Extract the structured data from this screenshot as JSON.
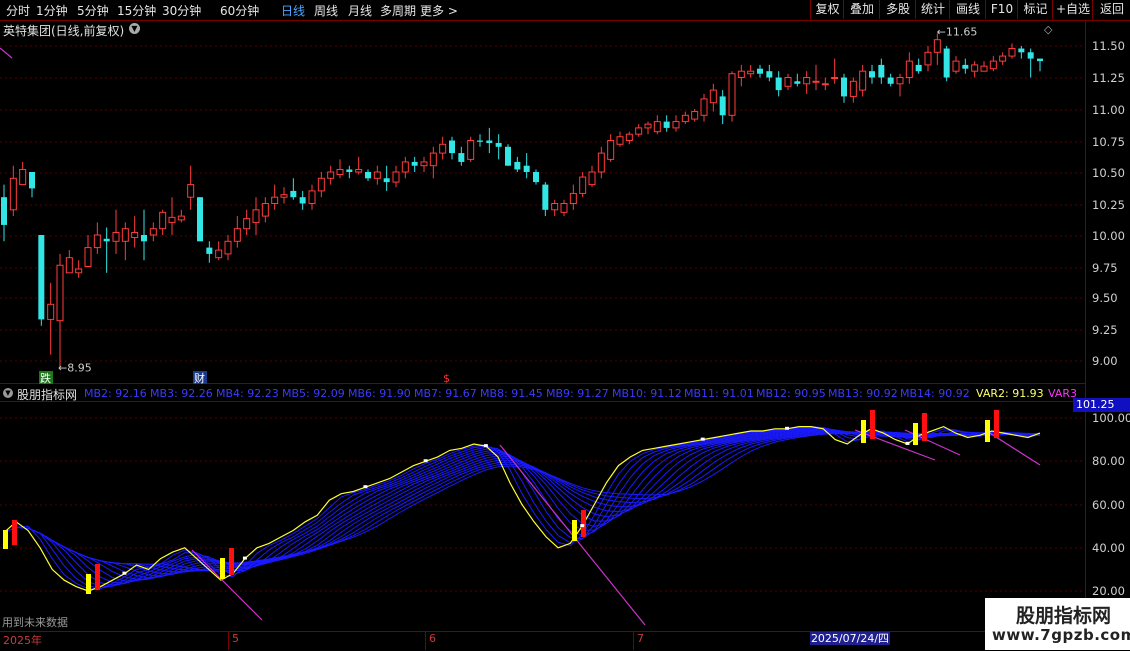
{
  "toolbar": {
    "left": [
      "分时",
      "1分钟",
      "5分钟",
      "15分钟",
      "30分钟",
      "60分钟",
      "日线",
      "周线",
      "月线",
      "多周期",
      "更多 >"
    ],
    "active_index": 6,
    "right": [
      "复权",
      "叠加",
      "多股",
      "统计",
      "画线",
      "F10",
      "标记",
      "+自选",
      "返回"
    ]
  },
  "chart_title": "英特集团(日线,前复权)",
  "price_axis": [
    "11.50",
    "11.25",
    "11.00",
    "10.75",
    "10.50",
    "10.25",
    "10.00",
    "9.75",
    "9.50",
    "9.25",
    "9.00"
  ],
  "price_annotations": {
    "high": "11.65",
    "low": "8.95"
  },
  "event_markers": [
    "跌",
    "财",
    "$"
  ],
  "indicator": {
    "name": "股朋指标网",
    "mb": [
      "MB2: 92.16",
      "MB3: 92.26",
      "MB4: 92.23",
      "MB5: 92.09",
      "MB6: 91.90",
      "MB7: 91.67",
      "MB8: 91.45",
      "MB9: 91.27",
      "MB10: 91.12",
      "MB11: 91.01",
      "MB12: 90.95",
      "MB13: 90.92",
      "MB14: 90.92"
    ],
    "var2": "VAR2: 91.93",
    "var3": "VAR3",
    "current_value": "101.25",
    "axis": [
      "100.00",
      "80.00",
      "60.00",
      "40.00",
      "20.00"
    ]
  },
  "note": "用到未来数据",
  "date_axis": {
    "labels": [
      "2025年",
      "5",
      "6",
      "7"
    ],
    "highlight": "2025/07/24/四"
  },
  "watermark": {
    "line1": "股朋指标网",
    "line2": "www.7gpzb.com"
  },
  "colors": {
    "up": "#ff3b3b",
    "down": "#33e6e6",
    "ribbon": "#1a1aff",
    "main_line": "#ffff33",
    "var3_line": "#cc33cc",
    "bar_yellow": "#ffff00",
    "bar_red": "#ff1010"
  },
  "chart_data": {
    "type": "candlestick",
    "candles": [
      {
        "o": 10.3,
        "h": 10.4,
        "l": 9.95,
        "c": 10.08
      },
      {
        "o": 10.2,
        "h": 10.55,
        "l": 10.15,
        "c": 10.45
      },
      {
        "o": 10.4,
        "h": 10.58,
        "l": 10.4,
        "c": 10.52
      },
      {
        "o": 10.5,
        "h": 10.5,
        "l": 10.3,
        "c": 10.37
      },
      {
        "o": 10.0,
        "h": 10.0,
        "l": 9.28,
        "c": 9.33
      },
      {
        "o": 9.33,
        "h": 9.62,
        "l": 9.05,
        "c": 9.45
      },
      {
        "o": 9.32,
        "h": 9.85,
        "l": 8.95,
        "c": 9.76
      },
      {
        "o": 9.7,
        "h": 9.88,
        "l": 9.7,
        "c": 9.82
      },
      {
        "o": 9.7,
        "h": 9.8,
        "l": 9.66,
        "c": 9.73
      },
      {
        "o": 9.75,
        "h": 10.0,
        "l": 9.75,
        "c": 9.9
      },
      {
        "o": 9.9,
        "h": 10.1,
        "l": 9.85,
        "c": 10.0
      },
      {
        "o": 9.97,
        "h": 10.06,
        "l": 9.7,
        "c": 9.95
      },
      {
        "o": 9.95,
        "h": 10.2,
        "l": 9.85,
        "c": 10.02
      },
      {
        "o": 9.95,
        "h": 10.1,
        "l": 9.8,
        "c": 10.05
      },
      {
        "o": 9.98,
        "h": 10.15,
        "l": 9.9,
        "c": 10.02
      },
      {
        "o": 10.0,
        "h": 10.2,
        "l": 9.8,
        "c": 9.95
      },
      {
        "o": 10.0,
        "h": 10.1,
        "l": 9.95,
        "c": 10.05
      },
      {
        "o": 10.05,
        "h": 10.2,
        "l": 10.0,
        "c": 10.18
      },
      {
        "o": 10.1,
        "h": 10.3,
        "l": 10.0,
        "c": 10.14
      },
      {
        "o": 10.12,
        "h": 10.2,
        "l": 10.1,
        "c": 10.15
      },
      {
        "o": 10.3,
        "h": 10.55,
        "l": 10.2,
        "c": 10.4
      },
      {
        "o": 10.3,
        "h": 10.3,
        "l": 9.95,
        "c": 9.95
      },
      {
        "o": 9.9,
        "h": 9.95,
        "l": 9.78,
        "c": 9.85
      },
      {
        "o": 9.82,
        "h": 9.95,
        "l": 9.8,
        "c": 9.88
      },
      {
        "o": 9.85,
        "h": 10.0,
        "l": 9.8,
        "c": 9.95
      },
      {
        "o": 9.95,
        "h": 10.15,
        "l": 9.9,
        "c": 10.05
      },
      {
        "o": 10.05,
        "h": 10.2,
        "l": 10.0,
        "c": 10.13
      },
      {
        "o": 10.1,
        "h": 10.3,
        "l": 10.0,
        "c": 10.2
      },
      {
        "o": 10.15,
        "h": 10.3,
        "l": 10.1,
        "c": 10.25
      },
      {
        "o": 10.25,
        "h": 10.4,
        "l": 10.2,
        "c": 10.3
      },
      {
        "o": 10.3,
        "h": 10.38,
        "l": 10.25,
        "c": 10.32
      },
      {
        "o": 10.35,
        "h": 10.45,
        "l": 10.28,
        "c": 10.3
      },
      {
        "o": 10.3,
        "h": 10.35,
        "l": 10.2,
        "c": 10.25
      },
      {
        "o": 10.25,
        "h": 10.4,
        "l": 10.2,
        "c": 10.35
      },
      {
        "o": 10.35,
        "h": 10.5,
        "l": 10.3,
        "c": 10.45
      },
      {
        "o": 10.45,
        "h": 10.55,
        "l": 10.4,
        "c": 10.5
      },
      {
        "o": 10.48,
        "h": 10.6,
        "l": 10.45,
        "c": 10.52
      },
      {
        "o": 10.52,
        "h": 10.55,
        "l": 10.45,
        "c": 10.5
      },
      {
        "o": 10.5,
        "h": 10.62,
        "l": 10.48,
        "c": 10.52
      },
      {
        "o": 10.5,
        "h": 10.52,
        "l": 10.43,
        "c": 10.45
      },
      {
        "o": 10.45,
        "h": 10.55,
        "l": 10.4,
        "c": 10.5
      },
      {
        "o": 10.45,
        "h": 10.55,
        "l": 10.35,
        "c": 10.42
      },
      {
        "o": 10.42,
        "h": 10.55,
        "l": 10.38,
        "c": 10.5
      },
      {
        "o": 10.5,
        "h": 10.62,
        "l": 10.45,
        "c": 10.58
      },
      {
        "o": 10.58,
        "h": 10.62,
        "l": 10.5,
        "c": 10.55
      },
      {
        "o": 10.55,
        "h": 10.62,
        "l": 10.5,
        "c": 10.58
      },
      {
        "o": 10.55,
        "h": 10.7,
        "l": 10.45,
        "c": 10.65
      },
      {
        "o": 10.65,
        "h": 10.78,
        "l": 10.6,
        "c": 10.72
      },
      {
        "o": 10.75,
        "h": 10.78,
        "l": 10.6,
        "c": 10.65
      },
      {
        "o": 10.65,
        "h": 10.7,
        "l": 10.55,
        "c": 10.58
      },
      {
        "o": 10.6,
        "h": 10.78,
        "l": 10.58,
        "c": 10.75
      },
      {
        "o": 10.75,
        "h": 10.8,
        "l": 10.7,
        "c": 10.74
      },
      {
        "o": 10.75,
        "h": 10.85,
        "l": 10.65,
        "c": 10.73
      },
      {
        "o": 10.73,
        "h": 10.8,
        "l": 10.6,
        "c": 10.7
      },
      {
        "o": 10.7,
        "h": 10.72,
        "l": 10.55,
        "c": 10.55
      },
      {
        "o": 10.58,
        "h": 10.62,
        "l": 10.5,
        "c": 10.52
      },
      {
        "o": 10.55,
        "h": 10.65,
        "l": 10.45,
        "c": 10.5
      },
      {
        "o": 10.5,
        "h": 10.52,
        "l": 10.4,
        "c": 10.42
      },
      {
        "o": 10.4,
        "h": 10.42,
        "l": 10.15,
        "c": 10.2
      },
      {
        "o": 10.2,
        "h": 10.28,
        "l": 10.15,
        "c": 10.25
      },
      {
        "o": 10.18,
        "h": 10.28,
        "l": 10.15,
        "c": 10.25
      },
      {
        "o": 10.25,
        "h": 10.4,
        "l": 10.2,
        "c": 10.33
      },
      {
        "o": 10.33,
        "h": 10.5,
        "l": 10.3,
        "c": 10.46
      },
      {
        "o": 10.4,
        "h": 10.55,
        "l": 10.38,
        "c": 10.5
      },
      {
        "o": 10.5,
        "h": 10.7,
        "l": 10.45,
        "c": 10.65
      },
      {
        "o": 10.6,
        "h": 10.8,
        "l": 10.58,
        "c": 10.75
      },
      {
        "o": 10.72,
        "h": 10.82,
        "l": 10.7,
        "c": 10.78
      },
      {
        "o": 10.75,
        "h": 10.82,
        "l": 10.72,
        "c": 10.8
      },
      {
        "o": 10.8,
        "h": 10.88,
        "l": 10.78,
        "c": 10.85
      },
      {
        "o": 10.85,
        "h": 10.9,
        "l": 10.8,
        "c": 10.88
      },
      {
        "o": 10.82,
        "h": 10.95,
        "l": 10.8,
        "c": 10.9
      },
      {
        "o": 10.9,
        "h": 10.95,
        "l": 10.82,
        "c": 10.85
      },
      {
        "o": 10.85,
        "h": 10.95,
        "l": 10.82,
        "c": 10.9
      },
      {
        "o": 10.9,
        "h": 10.98,
        "l": 10.88,
        "c": 10.95
      },
      {
        "o": 10.92,
        "h": 11.0,
        "l": 10.9,
        "c": 10.98
      },
      {
        "o": 10.95,
        "h": 11.12,
        "l": 10.9,
        "c": 11.08
      },
      {
        "o": 11.05,
        "h": 11.2,
        "l": 10.98,
        "c": 11.15
      },
      {
        "o": 11.1,
        "h": 11.15,
        "l": 10.88,
        "c": 10.95
      },
      {
        "o": 10.95,
        "h": 11.3,
        "l": 10.9,
        "c": 11.28
      },
      {
        "o": 11.25,
        "h": 11.35,
        "l": 11.18,
        "c": 11.3
      },
      {
        "o": 11.28,
        "h": 11.35,
        "l": 11.25,
        "c": 11.3
      },
      {
        "o": 11.32,
        "h": 11.35,
        "l": 11.25,
        "c": 11.28
      },
      {
        "o": 11.3,
        "h": 11.35,
        "l": 11.22,
        "c": 11.25
      },
      {
        "o": 11.25,
        "h": 11.3,
        "l": 11.1,
        "c": 11.15
      },
      {
        "o": 11.18,
        "h": 11.28,
        "l": 11.15,
        "c": 11.25
      },
      {
        "o": 11.22,
        "h": 11.28,
        "l": 11.18,
        "c": 11.2
      },
      {
        "o": 11.2,
        "h": 11.3,
        "l": 11.12,
        "c": 11.25
      },
      {
        "o": 11.22,
        "h": 11.35,
        "l": 11.15,
        "c": 11.22
      },
      {
        "o": 11.2,
        "h": 11.25,
        "l": 11.15,
        "c": 11.2
      },
      {
        "o": 11.25,
        "h": 11.4,
        "l": 11.2,
        "c": 11.25
      },
      {
        "o": 11.25,
        "h": 11.28,
        "l": 11.05,
        "c": 11.1
      },
      {
        "o": 11.1,
        "h": 11.25,
        "l": 11.05,
        "c": 11.22
      },
      {
        "o": 11.15,
        "h": 11.35,
        "l": 11.1,
        "c": 11.3
      },
      {
        "o": 11.3,
        "h": 11.35,
        "l": 11.2,
        "c": 11.25
      },
      {
        "o": 11.35,
        "h": 11.4,
        "l": 11.2,
        "c": 11.25
      },
      {
        "o": 11.25,
        "h": 11.28,
        "l": 11.18,
        "c": 11.2
      },
      {
        "o": 11.2,
        "h": 11.28,
        "l": 11.1,
        "c": 11.25
      },
      {
        "o": 11.25,
        "h": 11.45,
        "l": 11.2,
        "c": 11.38
      },
      {
        "o": 11.35,
        "h": 11.4,
        "l": 11.28,
        "c": 11.3
      },
      {
        "o": 11.35,
        "h": 11.5,
        "l": 11.3,
        "c": 11.45
      },
      {
        "o": 11.45,
        "h": 11.6,
        "l": 11.35,
        "c": 11.55
      },
      {
        "o": 11.48,
        "h": 11.5,
        "l": 11.22,
        "c": 11.25
      },
      {
        "o": 11.3,
        "h": 11.42,
        "l": 11.28,
        "c": 11.38
      },
      {
        "o": 11.35,
        "h": 11.4,
        "l": 11.28,
        "c": 11.32
      },
      {
        "o": 11.3,
        "h": 11.38,
        "l": 11.25,
        "c": 11.35
      },
      {
        "o": 11.3,
        "h": 11.38,
        "l": 11.3,
        "c": 11.34
      },
      {
        "o": 11.32,
        "h": 11.42,
        "l": 11.3,
        "c": 11.38
      },
      {
        "o": 11.38,
        "h": 11.45,
        "l": 11.35,
        "c": 11.42
      },
      {
        "o": 11.42,
        "h": 11.52,
        "l": 11.4,
        "c": 11.48
      },
      {
        "o": 11.48,
        "h": 11.5,
        "l": 11.4,
        "c": 11.45
      },
      {
        "o": 11.45,
        "h": 11.48,
        "l": 11.25,
        "c": 11.4
      },
      {
        "o": 11.4,
        "h": 11.4,
        "l": 11.3,
        "c": 11.38
      }
    ],
    "ylim": [
      8.9,
      11.6
    ],
    "indicator_main": [
      47,
      52,
      48,
      40,
      30,
      25,
      22,
      20,
      22,
      25,
      28,
      32,
      30,
      35,
      38,
      40,
      35,
      30,
      25,
      28,
      35,
      40,
      42,
      45,
      48,
      52,
      55,
      62,
      65,
      66,
      68,
      70,
      72,
      75,
      78,
      80,
      82,
      85,
      86,
      88,
      87,
      82,
      70,
      60,
      52,
      45,
      40,
      42,
      50,
      60,
      70,
      78,
      82,
      85,
      86,
      87,
      88,
      89,
      90,
      91,
      92,
      93,
      94,
      94,
      95,
      95,
      96,
      96,
      95,
      90,
      88,
      92,
      95,
      93,
      90,
      88,
      92,
      94,
      96,
      93,
      91,
      92,
      94,
      93,
      92,
      91,
      93
    ],
    "indicator_ylim": [
      15,
      105
    ]
  }
}
